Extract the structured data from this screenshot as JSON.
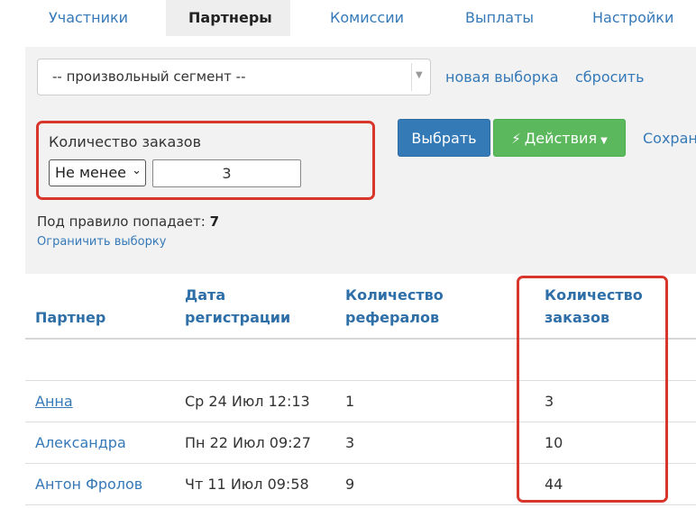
{
  "tabs": [
    {
      "label": "Участники",
      "active": false
    },
    {
      "label": "Партнеры",
      "active": true
    },
    {
      "label": "Комиссии",
      "active": false
    },
    {
      "label": "Выплаты",
      "active": false
    },
    {
      "label": "Настройки",
      "active": false
    }
  ],
  "filters": {
    "segment": {
      "value": "-- произвольный сегмент --"
    },
    "new_selection": "новая выборка",
    "reset": "сбросить",
    "rule": {
      "label": "Количество заказов",
      "operator": "Не менее",
      "value": "3"
    },
    "select_button": "Выбрать",
    "actions_button": "Действия",
    "save_link": "Сохран",
    "match_label": "Под правило попадает:",
    "match_count": "7",
    "limit_link": "Ограничить выборку"
  },
  "table": {
    "headers": [
      {
        "line1": "Партнер",
        "line2": ""
      },
      {
        "line1": "Дата",
        "line2": "регистрации"
      },
      {
        "line1": "Количество",
        "line2": "рефералов"
      },
      {
        "line1": "Количество",
        "line2": "заказов"
      }
    ],
    "rows": [
      {
        "name": "Анна",
        "date": "Ср 24 Июл 12:13",
        "referrals": "1",
        "orders": "3"
      },
      {
        "name": "Александра",
        "date": "Пн 22 Июл 09:27",
        "referrals": "3",
        "orders": "10"
      },
      {
        "name": "Антон Фролов",
        "date": "Чт 11 Июл 09:58",
        "referrals": "9",
        "orders": "44"
      }
    ]
  },
  "colors": {
    "link": "#3579b8",
    "primary_button": "#337ab7",
    "success_button": "#5cb85c",
    "highlight": "#d9362b"
  }
}
